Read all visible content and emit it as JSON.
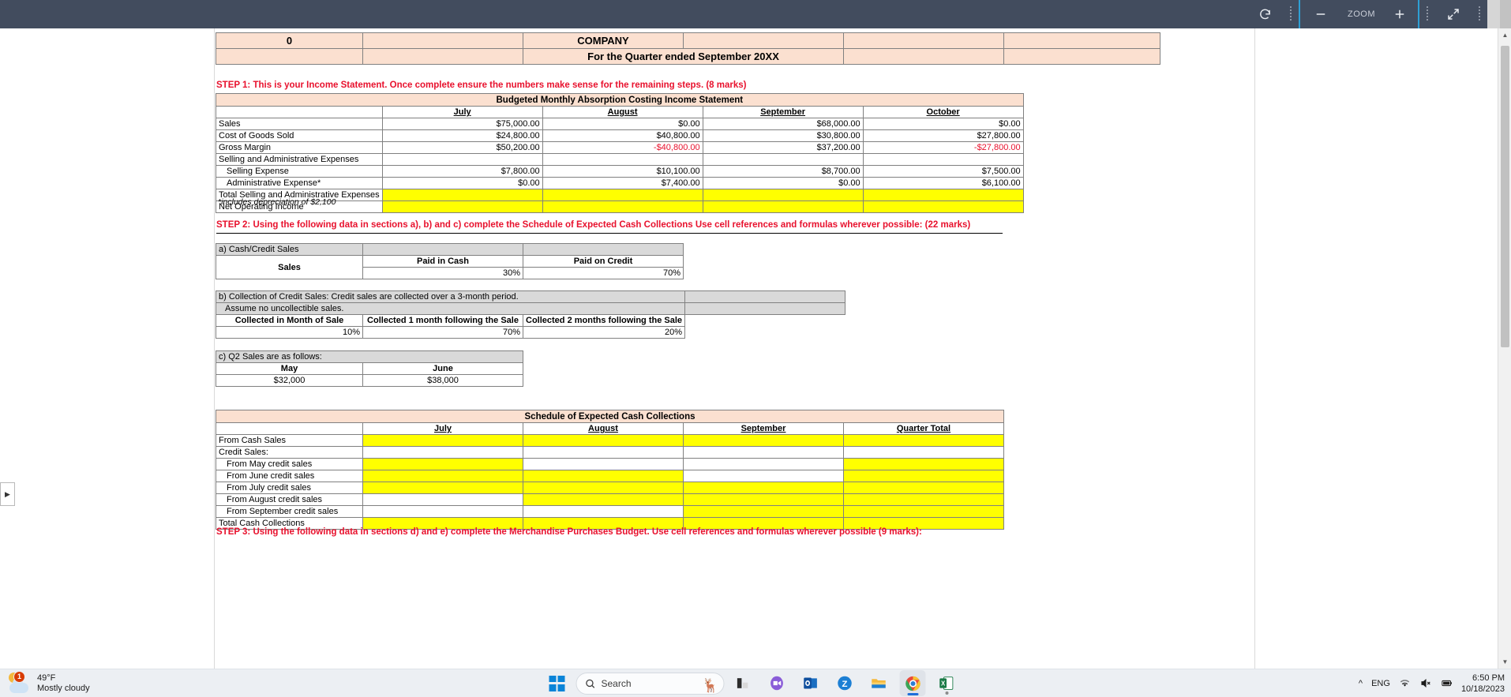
{
  "toolbar": {
    "rotate_icon": "rotate-icon",
    "minus_label": "−",
    "zoom_label": "ZOOM",
    "plus_label": "+",
    "fullscreen_icon": "expand-arrows-icon"
  },
  "document": {
    "company_number": "0",
    "company_title": "COMPANY",
    "period_title": "For the Quarter ended September 20XX",
    "step1": {
      "instruction": "STEP 1:  This is your Income Statement. Once complete ensure the numbers make sense for the remaining steps. (8 marks)",
      "table_title": "Budgeted Monthly Absorption Costing Income Statement",
      "columns": [
        "",
        "July",
        "August",
        "September",
        "October"
      ],
      "rows": [
        {
          "label": "Sales",
          "values": [
            "$75,000.00",
            "$0.00",
            "$68,000.00",
            "$0.00"
          ],
          "fill": "white",
          "indent": 0,
          "negative": [
            false,
            false,
            false,
            false
          ]
        },
        {
          "label": "Cost of Goods Sold",
          "values": [
            "$24,800.00",
            "$40,800.00",
            "$30,800.00",
            "$27,800.00"
          ],
          "fill": "white",
          "indent": 0,
          "negative": [
            false,
            false,
            false,
            false
          ]
        },
        {
          "label": "Gross Margin",
          "values": [
            "$50,200.00",
            "-$40,800.00",
            "$37,200.00",
            "-$27,800.00"
          ],
          "fill": "white",
          "indent": 0,
          "negative": [
            false,
            true,
            false,
            true
          ]
        },
        {
          "label": "Selling and Administrative Expenses",
          "values": [
            "",
            "",
            "",
            ""
          ],
          "fill": "white",
          "indent": 0,
          "negative": [
            false,
            false,
            false,
            false
          ]
        },
        {
          "label": "Selling Expense",
          "values": [
            "$7,800.00",
            "$10,100.00",
            "$8,700.00",
            "$7,500.00"
          ],
          "fill": "white",
          "indent": 1,
          "negative": [
            false,
            false,
            false,
            false
          ]
        },
        {
          "label": "Administrative Expense*",
          "values": [
            "$0.00",
            "$7,400.00",
            "$0.00",
            "$6,100.00"
          ],
          "fill": "white",
          "indent": 1,
          "negative": [
            false,
            false,
            false,
            false
          ]
        },
        {
          "label": "Total Selling and Administrative Expenses",
          "values": [
            "",
            "",
            "",
            ""
          ],
          "fill": "yellow",
          "indent": 0,
          "negative": [
            false,
            false,
            false,
            false
          ]
        },
        {
          "label": "Net Operating Income",
          "values": [
            "",
            "",
            "",
            ""
          ],
          "fill": "yellow",
          "indent": 0,
          "negative": [
            false,
            false,
            false,
            false
          ]
        }
      ],
      "footnote": "*includes depreciation of $2,100"
    },
    "step2": {
      "instruction": "STEP 2: Using the following data in sections a), b) and c) complete the Schedule of Expected Cash Collections  Use cell references and formulas wherever possible: (22 marks)",
      "section_a": {
        "heading": "a) Cash/Credit Sales",
        "row_label": "Sales",
        "columns": [
          "Paid in Cash",
          "Paid on Credit"
        ],
        "values": [
          "30%",
          "70%"
        ]
      },
      "section_b": {
        "heading_line1": "b) Collection of Credit Sales: Credit sales are collected over a 3-month period.",
        "heading_line2": "Assume no uncollectible sales.",
        "columns": [
          "Collected in Month of Sale",
          "Collected 1 month following the Sale",
          "Collected 2 months following the Sale"
        ],
        "values": [
          "10%",
          "70%",
          "20%"
        ]
      },
      "section_c": {
        "heading": "c) Q2 Sales are as follows:",
        "columns": [
          "May",
          "June"
        ],
        "values": [
          "$32,000",
          "$38,000"
        ]
      },
      "schedule": {
        "title": "Schedule of Expected Cash Collections",
        "columns": [
          "",
          "July",
          "August",
          "September",
          "Quarter Total"
        ],
        "rows": [
          {
            "label": "From Cash Sales",
            "indent": 0,
            "fills": [
              "yellow",
              "yellow",
              "yellow",
              "yellow"
            ]
          },
          {
            "label": "Credit Sales:",
            "indent": 0,
            "fills": [
              "white",
              "white",
              "white",
              "white"
            ]
          },
          {
            "label": "From May credit sales",
            "indent": 1,
            "fills": [
              "yellow",
              "white",
              "white",
              "yellow"
            ]
          },
          {
            "label": "From June credit sales",
            "indent": 1,
            "fills": [
              "yellow",
              "yellow",
              "white",
              "yellow"
            ]
          },
          {
            "label": "From July credit sales",
            "indent": 1,
            "fills": [
              "yellow",
              "yellow",
              "yellow",
              "yellow"
            ]
          },
          {
            "label": "From August credit sales",
            "indent": 1,
            "fills": [
              "white",
              "yellow",
              "yellow",
              "yellow"
            ]
          },
          {
            "label": "From September credit sales",
            "indent": 1,
            "fills": [
              "white",
              "white",
              "yellow",
              "yellow"
            ]
          },
          {
            "label": "Total Cash Collections",
            "indent": 0,
            "fills": [
              "yellow",
              "yellow",
              "yellow",
              "yellow"
            ]
          }
        ]
      }
    },
    "step3": {
      "instruction": "STEP 3: Using the following data in sections d) and  e) complete the Merchandise Purchases Budget.  Use cell references and formulas wherever possible (9 marks):"
    }
  },
  "taskbar": {
    "weather": {
      "badge": "1",
      "temperature": "49°F",
      "condition": "Mostly cloudy"
    },
    "search_placeholder": "Search",
    "apps": [
      "lenovo-icon",
      "zoom-app-icon",
      "outlook-icon",
      "zotero-icon",
      "file-explorer-icon",
      "chrome-icon",
      "excel-icon"
    ],
    "tray": {
      "language": "ENG",
      "time": "6:50 PM",
      "date": "10/18/2023"
    }
  },
  "colors": {
    "toolbar_bg": "#424c5e",
    "accent": "#2e9fd4",
    "peach": "#fbe0d0",
    "yellow": "#ffff00",
    "red": "#e8112d",
    "grey": "#d9d9d9"
  }
}
